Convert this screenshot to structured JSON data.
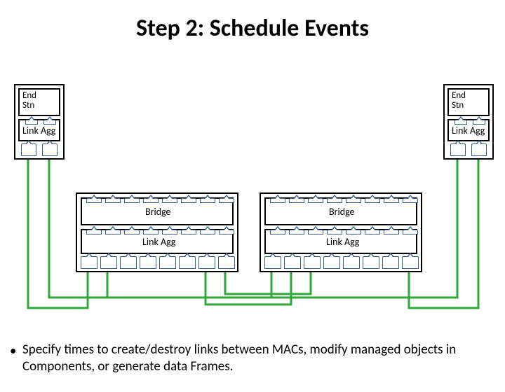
{
  "title": "Step 2:  Schedule Events",
  "endStn": {
    "left": "End\nStn",
    "right": "End\nStn"
  },
  "linkAgg": {
    "endLeft": "Link Agg",
    "endRight": "Link Agg",
    "bridge1": "Link Agg",
    "bridge2": "Link Agg"
  },
  "bridge": {
    "b1": "Bridge",
    "b2": "Bridge"
  },
  "bullet": "Specify times to create/destroy links between MACs, modify managed objects in Components, or generate data Frames."
}
